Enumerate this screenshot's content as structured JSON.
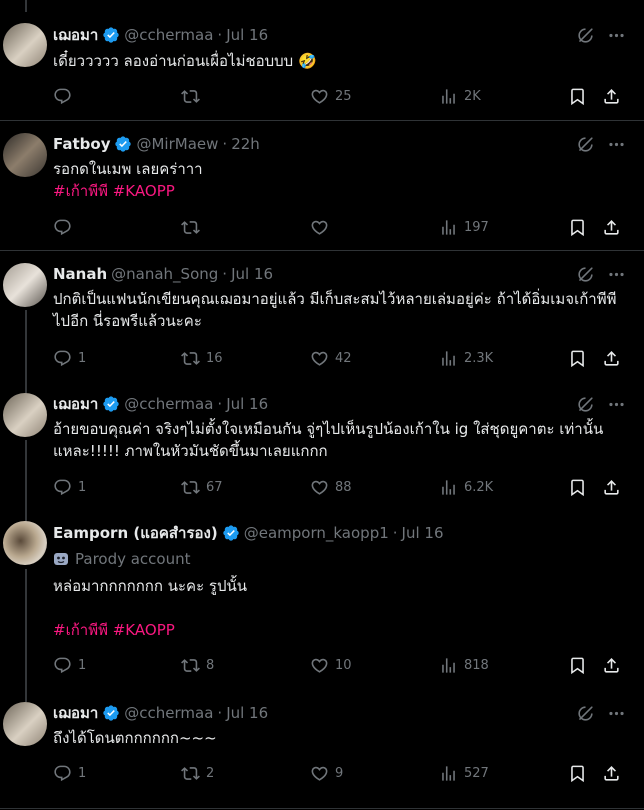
{
  "tweets": [
    {
      "name": "เฌอมา",
      "verified": true,
      "handle": "@cchermaa",
      "time": "Jul 16",
      "text": "เดี๋ยววววว ลองอ่านก่อนเผื่อไม่ชอบบบ 🤣",
      "replies": "",
      "reposts": "",
      "likes": "25",
      "views": "2K"
    },
    {
      "name": "Fatboy",
      "verified": true,
      "handle": "@MirMaew",
      "time": "22h",
      "text": "รอกดในเมพ เลยคร่าาา",
      "hashtags": "#เก้าพีพี #KAOPP",
      "replies": "",
      "reposts": "",
      "likes": "",
      "views": "197"
    },
    {
      "name": "Nanah",
      "verified": false,
      "handle": "@nanah_Song",
      "time": "Jul 16",
      "text": "ปกติเป็นแฟนนักเขียนคุณเฌอมาอยู่แล้ว มีเก็บสะสมไว้หลายเล่มอยู่ค่ะ ถ้าได้อิ่มเมจเก้าพีพีไปอีก นี่รอพรีแล้วนะคะ",
      "replies": "1",
      "reposts": "16",
      "likes": "42",
      "views": "2.3K"
    },
    {
      "name": "เฌอมา",
      "verified": true,
      "handle": "@cchermaa",
      "time": "Jul 16",
      "text": "อ้ายขอบคุณค่า จริงๆไม่ตั้งใจเหมือนกัน จู่ๆไปเห็นรูปน้องเก้าใน ig ใส่ชุดยูคาตะ เท่านั้นแหละ!!!!! ภาพในหัวมันชัดขึ้นมาเลยแกกก",
      "replies": "1",
      "reposts": "67",
      "likes": "88",
      "views": "6.2K"
    },
    {
      "name": "Eamporn (แอคสำรอง)",
      "verified": true,
      "handle": "@eamporn_kaopp1",
      "time": "Jul 16",
      "parody": "Parody account",
      "text": "หล่อมากกกกกกก นะคะ รูปนั้น",
      "hashtags": "#เก้าพีพี #KAOPP",
      "replies": "1",
      "reposts": "8",
      "likes": "10",
      "views": "818"
    },
    {
      "name": "เฌอมา",
      "verified": true,
      "handle": "@cchermaa",
      "time": "Jul 16",
      "text": "ถึงได้โดนตกกกกกก~~~",
      "replies": "1",
      "reposts": "2",
      "likes": "9",
      "views": "527"
    }
  ],
  "icons": {
    "reply": "reply-icon",
    "repost": "repost-icon",
    "like": "like-icon",
    "views": "views-icon",
    "bookmark": "bookmark-icon",
    "share": "share-icon",
    "grok": "grok-icon",
    "more": "more-icon",
    "verified": "verified-badge-icon",
    "parody": "mask-icon"
  },
  "colors": {
    "background": "#000000",
    "text": "#e7e9ea",
    "muted": "#71767b",
    "verified": "#1d9bf0",
    "hashtag": "#f91880",
    "divider": "#2f3336"
  }
}
